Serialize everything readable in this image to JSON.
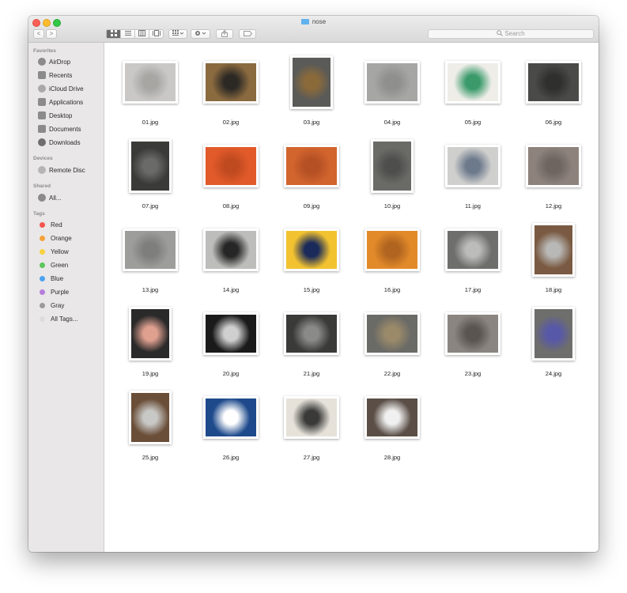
{
  "window": {
    "title": "nose"
  },
  "toolbar": {
    "back_label": "<",
    "forward_label": ">",
    "search_placeholder": "Search",
    "search_icon": "magnifier-icon"
  },
  "sidebar": {
    "favorites_header": "Favorites",
    "favorites": [
      {
        "label": "AirDrop",
        "icon": "airdrop-icon"
      },
      {
        "label": "Recents",
        "icon": "clock-icon"
      },
      {
        "label": "iCloud Drive",
        "icon": "cloud-icon"
      },
      {
        "label": "Applications",
        "icon": "applications-icon"
      },
      {
        "label": "Desktop",
        "icon": "desktop-icon"
      },
      {
        "label": "Documents",
        "icon": "document-icon"
      },
      {
        "label": "Downloads",
        "icon": "download-icon"
      }
    ],
    "devices_header": "Devices",
    "devices": [
      {
        "label": "Remote Disc",
        "icon": "disc-icon"
      }
    ],
    "shared_header": "Shared",
    "shared": [
      {
        "label": "All...",
        "icon": "globe-icon"
      }
    ],
    "tags_header": "Tags",
    "tags": [
      {
        "label": "Red",
        "color": "#f4544e"
      },
      {
        "label": "Orange",
        "color": "#f7a13a"
      },
      {
        "label": "Yellow",
        "color": "#f8d23e"
      },
      {
        "label": "Green",
        "color": "#5cc65b"
      },
      {
        "label": "Blue",
        "color": "#4ea1f1"
      },
      {
        "label": "Purple",
        "color": "#b77ddb"
      },
      {
        "label": "Gray",
        "color": "#9a9a9a"
      },
      {
        "label": "All Tags...",
        "color": "#dcdcdc"
      }
    ]
  },
  "files": [
    {
      "name": "01.jpg",
      "orientation": "landscape",
      "colors": [
        "#c9c8c6",
        "#a7a6a3"
      ]
    },
    {
      "name": "02.jpg",
      "orientation": "landscape",
      "colors": [
        "#8a6a3f",
        "#2c2925"
      ]
    },
    {
      "name": "03.jpg",
      "orientation": "portrait",
      "colors": [
        "#5a5a58",
        "#8b6a3a"
      ]
    },
    {
      "name": "04.jpg",
      "orientation": "landscape",
      "colors": [
        "#a6a6a4",
        "#8f8f8d"
      ]
    },
    {
      "name": "05.jpg",
      "orientation": "landscape",
      "colors": [
        "#eeede8",
        "#3a9a6a"
      ]
    },
    {
      "name": "06.jpg",
      "orientation": "landscape",
      "colors": [
        "#4a4a48",
        "#2f2f2e"
      ]
    },
    {
      "name": "07.jpg",
      "orientation": "portrait",
      "colors": [
        "#3a3a38",
        "#6a6a68"
      ]
    },
    {
      "name": "08.jpg",
      "orientation": "landscape",
      "colors": [
        "#e25a2a",
        "#c04a20"
      ]
    },
    {
      "name": "09.jpg",
      "orientation": "landscape",
      "colors": [
        "#d2642e",
        "#b45024"
      ]
    },
    {
      "name": "10.jpg",
      "orientation": "portrait",
      "colors": [
        "#6a6a66",
        "#4e4e4c"
      ]
    },
    {
      "name": "11.jpg",
      "orientation": "landscape",
      "colors": [
        "#cfcfcd",
        "#6d7a8c"
      ]
    },
    {
      "name": "12.jpg",
      "orientation": "landscape",
      "colors": [
        "#8d827c",
        "#6e6561"
      ]
    },
    {
      "name": "13.jpg",
      "orientation": "landscape",
      "colors": [
        "#9d9d9b",
        "#7e7e7c"
      ]
    },
    {
      "name": "14.jpg",
      "orientation": "landscape",
      "colors": [
        "#bdbdbb",
        "#262626"
      ]
    },
    {
      "name": "15.jpg",
      "orientation": "landscape",
      "colors": [
        "#f2c230",
        "#1a2a5a"
      ]
    },
    {
      "name": "16.jpg",
      "orientation": "landscape",
      "colors": [
        "#e28a2a",
        "#b06420"
      ]
    },
    {
      "name": "17.jpg",
      "orientation": "landscape",
      "colors": [
        "#6e6e6c",
        "#bcbcba"
      ]
    },
    {
      "name": "18.jpg",
      "orientation": "portrait",
      "colors": [
        "#7a5a42",
        "#b8b8b6"
      ]
    },
    {
      "name": "19.jpg",
      "orientation": "portrait",
      "colors": [
        "#2a2a2a",
        "#e0a090"
      ]
    },
    {
      "name": "20.jpg",
      "orientation": "landscape",
      "colors": [
        "#1a1a1a",
        "#cfcfcf"
      ]
    },
    {
      "name": "21.jpg",
      "orientation": "landscape",
      "colors": [
        "#3a3a38",
        "#8a8a88"
      ]
    },
    {
      "name": "22.jpg",
      "orientation": "landscape",
      "colors": [
        "#6a6a66",
        "#9a8a6a"
      ]
    },
    {
      "name": "23.jpg",
      "orientation": "landscape",
      "colors": [
        "#8a8580",
        "#5a5550"
      ]
    },
    {
      "name": "24.jpg",
      "orientation": "portrait",
      "colors": [
        "#6e6e6c",
        "#5858a8"
      ]
    },
    {
      "name": "25.jpg",
      "orientation": "portrait",
      "colors": [
        "#6a4e38",
        "#c8c8c6"
      ]
    },
    {
      "name": "26.jpg",
      "orientation": "landscape",
      "colors": [
        "#1e4a8c",
        "#ffffff"
      ]
    },
    {
      "name": "27.jpg",
      "orientation": "landscape",
      "colors": [
        "#e6e2da",
        "#3a3a38"
      ]
    },
    {
      "name": "28.jpg",
      "orientation": "landscape",
      "colors": [
        "#5a4e46",
        "#f0f0f0"
      ]
    }
  ]
}
